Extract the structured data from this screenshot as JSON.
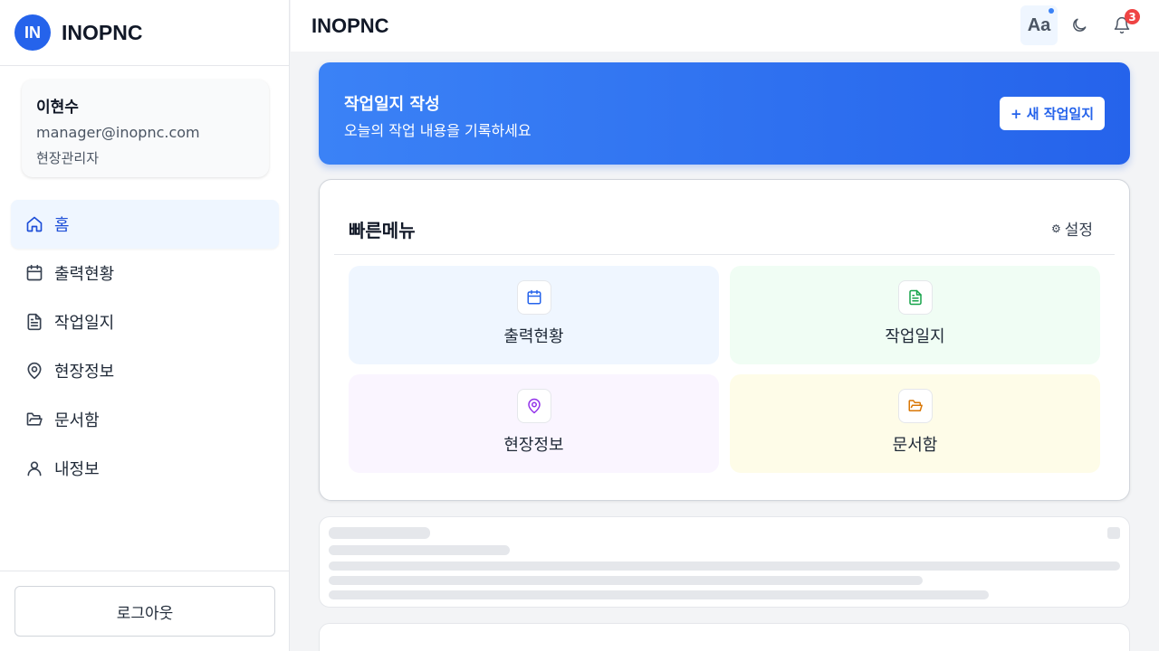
{
  "app": {
    "brand_logo": "IN",
    "brand_name": "INOPNC",
    "header_title": "INOPNC",
    "accent_color": "#2563eb"
  },
  "profile": {
    "name": "이현수",
    "email": "manager@inopnc.com",
    "role": "현장관리자"
  },
  "nav": {
    "items": [
      {
        "label": "홈",
        "icon": "home-icon",
        "active": true
      },
      {
        "label": "출력현황",
        "icon": "calendar-icon"
      },
      {
        "label": "작업일지",
        "icon": "document-icon"
      },
      {
        "label": "현장정보",
        "icon": "map-pin-icon"
      },
      {
        "label": "문서함",
        "icon": "folder-open-icon"
      },
      {
        "label": "내정보",
        "icon": "user-icon"
      }
    ],
    "logout_label": "로그아웃"
  },
  "header": {
    "font_size_label": "Aa",
    "notification_count": "3"
  },
  "banner": {
    "title": "작업일지 작성",
    "subtitle": "오늘의 작업 내용을 기록하세요",
    "button_label": "+ 새 작업일지"
  },
  "quick_menu": {
    "title": "빠른메뉴",
    "settings_label": "설정",
    "tiles": [
      {
        "label": "출력현황",
        "icon": "calendar-icon",
        "color": "#2563eb"
      },
      {
        "label": "작업일지",
        "icon": "document-icon",
        "color": "#16a34a"
      },
      {
        "label": "현장정보",
        "icon": "map-pin-icon",
        "color": "#9333ea"
      },
      {
        "label": "문서함",
        "icon": "folder-open-icon",
        "color": "#d97706"
      }
    ]
  }
}
